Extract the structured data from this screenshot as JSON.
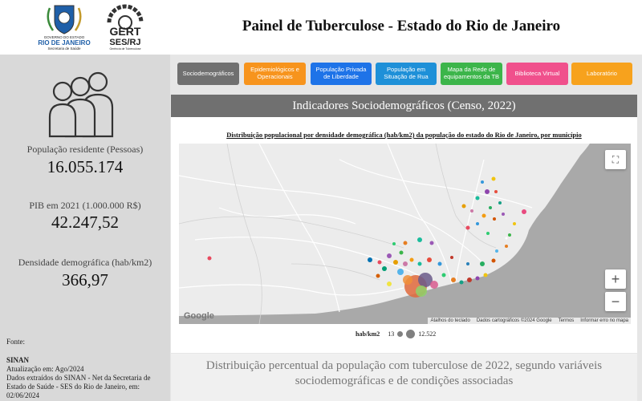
{
  "header": {
    "title": "Painel de Tuberculose - Estado do Rio de Janeiro",
    "logo_rj": {
      "line1": "GOVERNO DO ESTADO",
      "line2": "RIO DE JANEIRO",
      "line3": "Secretaria de Saúde"
    },
    "logo_gert": {
      "line1": "GERT",
      "line2": "SES/RJ",
      "line3": "Gerência de Tuberculose"
    }
  },
  "sidebar": {
    "stats": [
      {
        "label": "População residente (Pessoas)",
        "value": "16.055.174"
      },
      {
        "label": "PIB em 2021 (1.000.000 R$)",
        "value": "42.247,52"
      },
      {
        "label": "Densidade demográfica (hab/km2)",
        "value": "366,97"
      }
    ],
    "source": {
      "label": "Fonte:",
      "name": "SINAN",
      "updated": "Atualização em: Ago/2024",
      "line1": "Dados extraídos do SINAN - Net da Secretaria de",
      "line2": "Estado de Saúde - SES do Rio de Janeiro, em:",
      "line3": "02/06/2024"
    }
  },
  "nav": [
    {
      "label": "Sociodemográficos",
      "color": "#707070"
    },
    {
      "label": "Epidemiológicos e Operacionais",
      "color": "#f7941d"
    },
    {
      "label": "População Privada de Liberdade",
      "color": "#1e73e8"
    },
    {
      "label": "População em Situação de Rua",
      "color": "#1e90d8"
    },
    {
      "label": "Mapa da Rede de equipamentos da TB",
      "color": "#3cb54a"
    },
    {
      "label": "Biblioteca Virtual",
      "color": "#f0508c"
    },
    {
      "label": "Laboratório",
      "color": "#f7a21d"
    }
  ],
  "section": {
    "title": "Indicadores Sociodemográficos (Censo, 2022)"
  },
  "map": {
    "title": "Distribuição populacional por densidade demográfica (hab/km2) da população do estado do Rio de Janeiro, por município",
    "attribution": {
      "shortcuts": "Atalhos do teclado",
      "data": "Dados cartográficos ©2024 Google",
      "terms": "Termos",
      "report": "Informar erro no mapa"
    },
    "google_label": "Google",
    "zoom_in": "+",
    "zoom_out": "−",
    "legend": {
      "label": "hab/km2",
      "min": "13",
      "max": "12.522"
    }
  },
  "bottom": {
    "line1": "Distribuição percentual da população com tuberculose de 2022, segundo variáveis",
    "line2": "sociodemográficas e de condições associadas"
  },
  "colors": {
    "sidebar_bg": "#d9d9d9",
    "section_header": "#707070",
    "map_land": "#ececec",
    "sea": "#a9a9a9"
  }
}
